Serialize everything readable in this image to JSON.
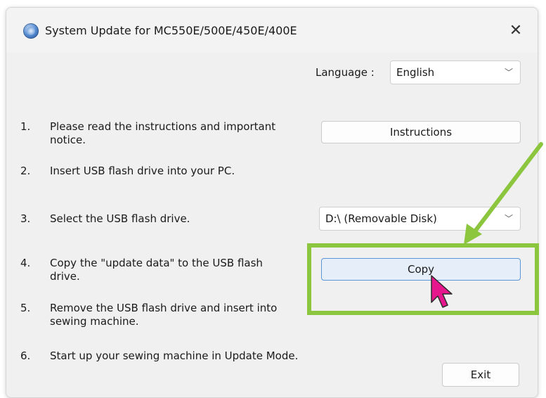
{
  "window": {
    "title": "System Update for MC550E/500E/450E/400E",
    "close_glyph": "✕",
    "icon": "app-globe-icon"
  },
  "language": {
    "label": "Language :",
    "selected": "English"
  },
  "steps": [
    {
      "num": "1.",
      "text": "Please read the instructions and important notice."
    },
    {
      "num": "2.",
      "text": "Insert USB flash drive into your PC."
    },
    {
      "num": "3.",
      "text": "Select the USB flash drive."
    },
    {
      "num": "4.",
      "text": "Copy the \"update data\" to the USB flash drive."
    },
    {
      "num": "5.",
      "text": "Remove the USB flash drive and insert into sewing machine."
    },
    {
      "num": "6.",
      "text": "Start up your sewing machine in Update Mode."
    }
  ],
  "buttons": {
    "instructions": "Instructions",
    "copy": "Copy",
    "exit": "Exit"
  },
  "drive": {
    "selected": "D:\\ (Removable Disk)"
  },
  "annotation": {
    "highlight_color": "#8cc63f",
    "cursor_color": "#e6178c",
    "icons": [
      "annotation-arrow-icon",
      "mouse-cursor-icon"
    ]
  }
}
